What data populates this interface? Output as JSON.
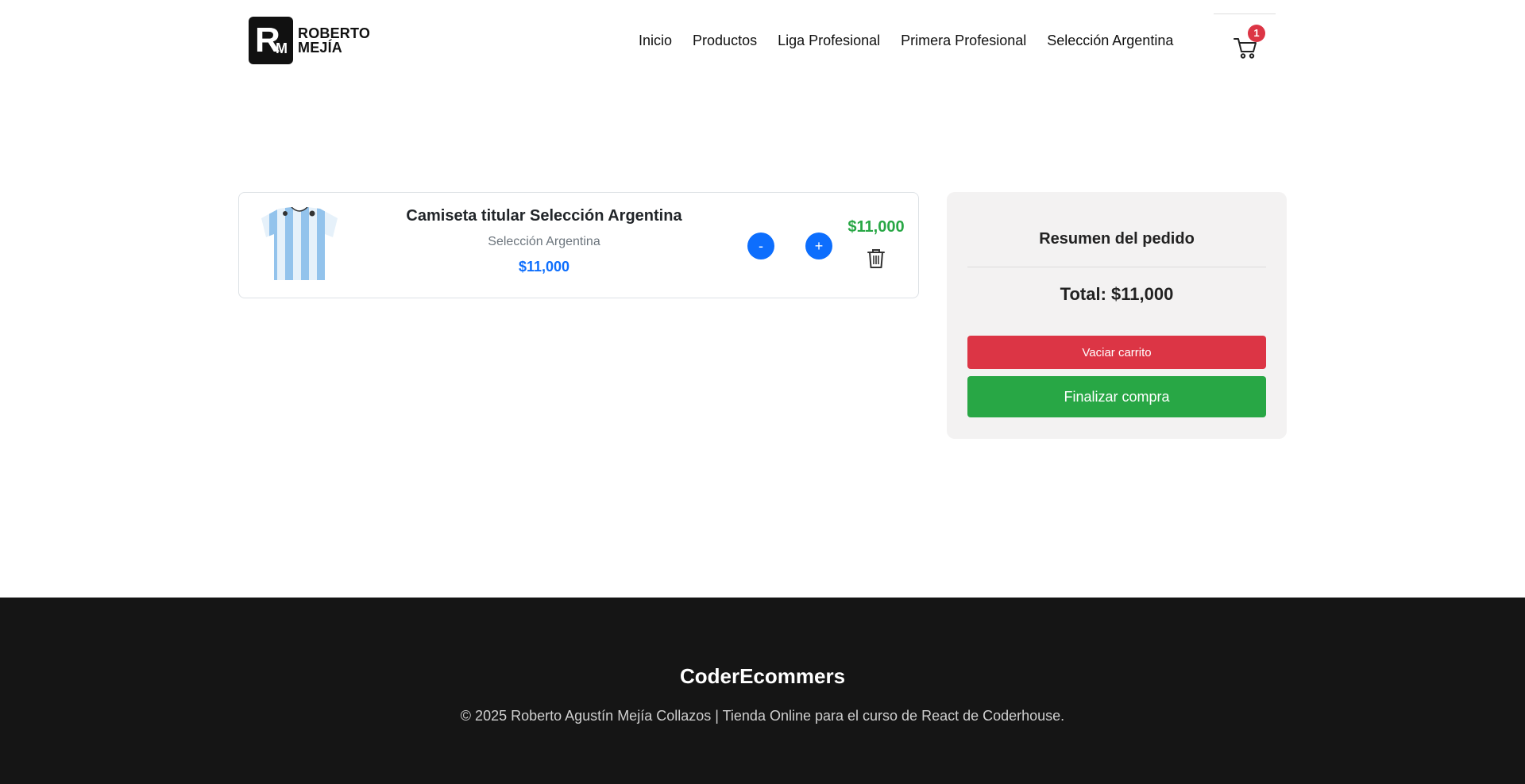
{
  "brand": {
    "line1": "ROBERTO",
    "line2": "MEJÍA",
    "mark": "R",
    "mark_small": "M"
  },
  "nav": {
    "items": [
      {
        "label": "Inicio"
      },
      {
        "label": "Productos"
      },
      {
        "label": "Liga Profesional"
      },
      {
        "label": "Primera Profesional"
      },
      {
        "label": "Selección Argentina"
      }
    ]
  },
  "cart": {
    "icon": "cart-icon",
    "count": "1",
    "badge_color": "#dc3545"
  },
  "cart_items": [
    {
      "title": "Camiseta titular Selección Argentina",
      "category": "Selección Argentina",
      "unit_price": "$11,000",
      "minus_label": "-",
      "plus_label": "+",
      "subtotal": "$11,000",
      "delete_icon": "trash-icon"
    }
  ],
  "summary": {
    "title": "Resumen del pedido",
    "total": "Total: $11,000",
    "clear_label": "Vaciar carrito",
    "checkout_label": "Finalizar compra"
  },
  "footer": {
    "title": "CoderEcommers",
    "copyright": "© 2025 Roberto Agustín Mejía Collazos | Tienda Online para el curso de React de Coderhouse."
  },
  "colors": {
    "primary": "#0d6efd",
    "success": "#28a745",
    "danger": "#dc3545",
    "summary_bg": "#f3f2f2",
    "footer_bg": "#151515"
  }
}
